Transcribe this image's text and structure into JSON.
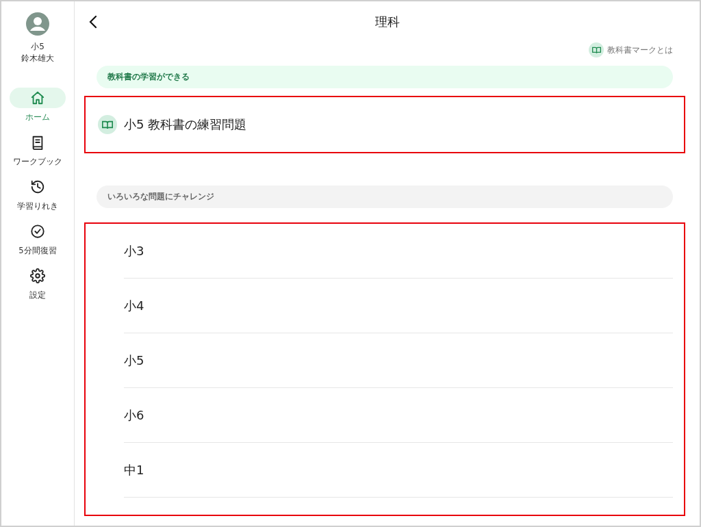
{
  "user": {
    "grade": "小5",
    "name": "鈴木雄大"
  },
  "nav": [
    {
      "kind": "home",
      "label": "ホーム",
      "selected": true
    },
    {
      "kind": "workbook",
      "label": "ワークブック",
      "selected": false
    },
    {
      "kind": "history",
      "label": "学習りれき",
      "selected": false
    },
    {
      "kind": "review",
      "label": "5分間復習",
      "selected": false
    },
    {
      "kind": "settings",
      "label": "設定",
      "selected": false
    }
  ],
  "header": {
    "title": "理科"
  },
  "textbook_mark_link": "教科書マークとは",
  "textbook_section": {
    "banner": "教科書の学習ができる",
    "highlighted": true,
    "item": "小5 教科書の練習問題"
  },
  "challenge_section": {
    "banner": "いろいろな問題にチャレンジ",
    "highlighted": true,
    "grades": [
      "小3",
      "小4",
      "小5",
      "小6",
      "中1"
    ]
  }
}
